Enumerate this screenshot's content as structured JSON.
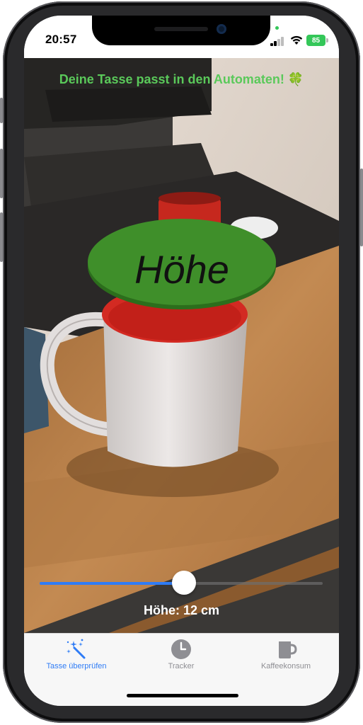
{
  "status_bar": {
    "time": "20:57",
    "battery": "85"
  },
  "ar_view": {
    "banner": "Deine Tasse passt in den Automaten! 🍀",
    "disc_label": "Höhe",
    "height_label": "Höhe: 12 cm",
    "slider_value_fraction": 0.51
  },
  "tab_bar": {
    "tabs": [
      {
        "label": "Tasse überprüfen",
        "icon": "magic-wand-icon",
        "active": true
      },
      {
        "label": "Tracker",
        "icon": "clock-icon",
        "active": false
      },
      {
        "label": "Kaffeekonsum",
        "icon": "mug-icon",
        "active": false
      }
    ]
  },
  "colors": {
    "accent": "#2f7cf6",
    "banner_text": "#5ac95a",
    "disc": "#3f8f2a",
    "tab_inactive": "#8e8e93"
  }
}
